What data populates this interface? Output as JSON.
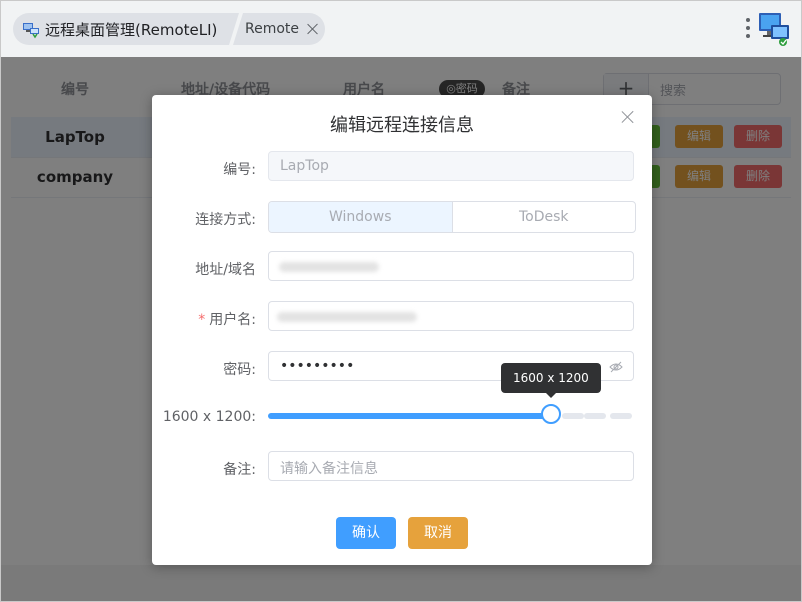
{
  "browser": {
    "active_tab_title": "远程桌面管理(RemoteLI)",
    "inactive_tab_title": "Remote"
  },
  "table": {
    "headers": [
      "编号",
      "地址/设备代码",
      "用户名",
      "密码",
      "备注"
    ],
    "rows": [
      {
        "id": "LapTop",
        "edit_label": "编辑",
        "delete_label": "删除"
      },
      {
        "id": "company",
        "edit_label": "编辑",
        "delete_label": "删除"
      }
    ],
    "add_label": "+",
    "search_placeholder": "搜索"
  },
  "dialog": {
    "title": "编辑远程连接信息",
    "fields": {
      "id_label": "编号:",
      "id_value": "LapTop",
      "conn_label": "连接方式:",
      "conn_options": [
        "Windows",
        "ToDesk"
      ],
      "conn_selected": "Windows",
      "addr_label": "地址/域名",
      "user_label": "用户名:",
      "user_required_mark": "*",
      "pwd_label": "密码:",
      "pwd_value": "•••••••••",
      "res_label": "1600 x 1200:",
      "res_value": "1600 x 1200",
      "res_slider_fraction": 0.77,
      "note_label": "备注:",
      "note_placeholder": "请输入备注信息"
    },
    "confirm_label": "确认",
    "cancel_label": "取消"
  },
  "colors": {
    "primary": "#409eff",
    "warning": "#e6a23c",
    "danger": "#f56c6c",
    "success": "#67c23a"
  }
}
